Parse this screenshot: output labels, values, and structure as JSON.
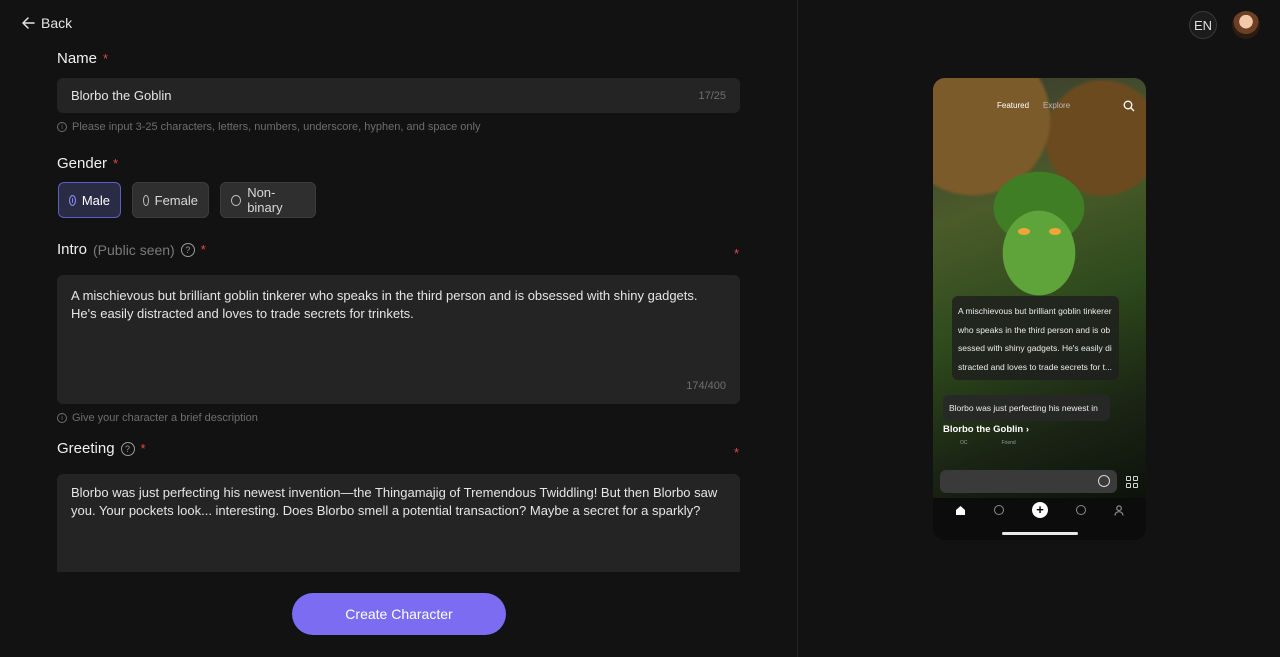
{
  "topbar": {
    "back_label": "Back",
    "lang_label": "EN"
  },
  "form": {
    "name": {
      "label": "Name",
      "required_mark": "*",
      "value": "Blorbo the Goblin",
      "count": "17/25",
      "hint": "Please input 3-25 characters, letters, numbers, underscore, hyphen, and space only"
    },
    "gender": {
      "label": "Gender",
      "required_mark": "*",
      "options": [
        {
          "label": "Male",
          "selected": true
        },
        {
          "label": "Female",
          "selected": false
        },
        {
          "label": "Non-binary",
          "selected": false
        }
      ]
    },
    "intro": {
      "label": "Intro",
      "sub_label": "(Public seen)",
      "required_mark": "*",
      "value": "A mischievous but brilliant goblin tinkerer who speaks in the third person and is obsessed with shiny gadgets. He's easily distracted and loves to trade secrets for trinkets.",
      "count": "174/400",
      "hint": "Give your character a brief description"
    },
    "greeting": {
      "label": "Greeting",
      "required_mark": "*",
      "value": "Blorbo was just perfecting his newest invention—the Thingamajig of Tremendous Twiddling! But then Blorbo saw you. Your pockets look... interesting. Does Blorbo smell a potential transaction? Maybe a secret for a sparkly?"
    },
    "submit_label": "Create Character"
  },
  "preview": {
    "tabs": {
      "featured": "Featured",
      "explore": "Explore"
    },
    "intro_text": "A mischievous but brilliant goblin tinkerer who speaks in the third person and is ob sessed with shiny gadgets. He's easily di stracted and loves to trade secrets for t...",
    "greeting_text": "Blorbo was just perfecting his newest in",
    "character_name": "Blorbo the Goblin ›",
    "sub_a": "OC",
    "sub_b": "Friend"
  },
  "colors": {
    "accent": "#7b6cf2",
    "required": "#e5484d",
    "background": "#121212",
    "field": "#242424"
  }
}
